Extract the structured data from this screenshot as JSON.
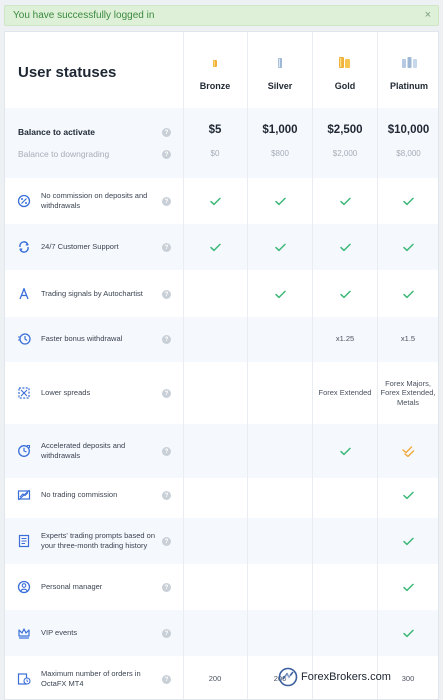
{
  "alert": {
    "message": "You have successfully logged in",
    "close": "×"
  },
  "title": "User statuses",
  "tiers": [
    "Bronze",
    "Silver",
    "Gold",
    "Platinum"
  ],
  "balance": {
    "activate_label": "Balance to activate",
    "downgrade_label": "Balance to downgrading",
    "activate": [
      "$5",
      "$1,000",
      "$2,500",
      "$10,000"
    ],
    "downgrade": [
      "$0",
      "$800",
      "$2,000",
      "$8,000"
    ]
  },
  "help_glyph": "?",
  "features": [
    {
      "label": "No commission on deposits and withdrawals",
      "icon": "percent-circle-icon",
      "values": [
        "check",
        "check",
        "check",
        "check"
      ]
    },
    {
      "label": "24/7 Customer Support",
      "icon": "support-cycle-icon",
      "values": [
        "check",
        "check",
        "check",
        "check"
      ]
    },
    {
      "label": "Trading signals by Autochartist",
      "icon": "signal-tower-icon",
      "values": [
        "",
        "check",
        "check",
        "check"
      ]
    },
    {
      "label": "Faster bonus withdrawal",
      "icon": "fast-clock-icon",
      "values": [
        "",
        "",
        "x1.25",
        "x1.5"
      ]
    },
    {
      "label": "Lower spreads",
      "icon": "spread-compress-icon",
      "values": [
        "",
        "",
        "Forex Extended",
        "Forex Majors, Forex Extended, Metals"
      ]
    },
    {
      "label": "Accelerated deposits and withdrawals",
      "icon": "accelerated-clock-icon",
      "values": [
        "",
        "",
        "check",
        "double-check"
      ]
    },
    {
      "label": "No trading commission",
      "icon": "no-commission-chart-icon",
      "values": [
        "",
        "",
        "",
        "check"
      ]
    },
    {
      "label": "Experts' trading prompts based on your three-month trading history",
      "icon": "expert-document-icon",
      "values": [
        "",
        "",
        "",
        "check"
      ]
    },
    {
      "label": "Personal manager",
      "icon": "person-circle-icon",
      "values": [
        "",
        "",
        "",
        "check"
      ]
    },
    {
      "label": "VIP events",
      "icon": "crown-icon",
      "values": [
        "",
        "",
        "",
        "check"
      ]
    },
    {
      "label": "Maximum number of orders in OctaFX MT4",
      "icon": "orders-clock-icon",
      "values": [
        "200",
        "200",
        "",
        "300"
      ]
    }
  ],
  "watermark": {
    "text": "ForexBrokers.com"
  },
  "colors": {
    "check": "#3cb878",
    "double_check": "#f2a93b",
    "alert_bg": "#dff0d8",
    "alert_text": "#3a8a3e",
    "alt_row": "#f5f8fc"
  }
}
